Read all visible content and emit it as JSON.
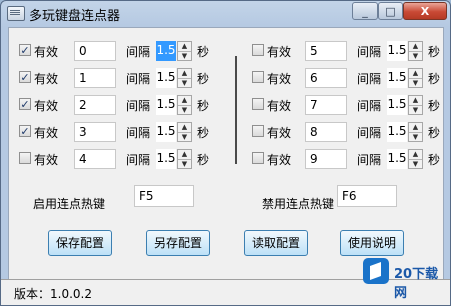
{
  "window": {
    "title": "多玩键盘连点器",
    "close_glyph": "X",
    "min_glyph": "_",
    "max_glyph": "□"
  },
  "labels": {
    "effective": "有效",
    "interval": "间隔",
    "seconds": "秒"
  },
  "left_rows": [
    {
      "checked": true,
      "key": "0",
      "interval": "1.5"
    },
    {
      "checked": true,
      "key": "1",
      "interval": "1.5"
    },
    {
      "checked": true,
      "key": "2",
      "interval": "1.5"
    },
    {
      "checked": true,
      "key": "3",
      "interval": "1.5"
    },
    {
      "checked": false,
      "key": "4",
      "interval": "1.5"
    }
  ],
  "right_rows": [
    {
      "checked": false,
      "key": "5",
      "interval": "1.5"
    },
    {
      "checked": false,
      "key": "6",
      "interval": "1.5"
    },
    {
      "checked": false,
      "key": "7",
      "interval": "1.5"
    },
    {
      "checked": false,
      "key": "8",
      "interval": "1.5"
    },
    {
      "checked": false,
      "key": "9",
      "interval": "1.5"
    }
  ],
  "hotkeys": {
    "enable_label": "启用连点热键",
    "enable_value": "F5",
    "disable_label": "禁用连点热键",
    "disable_value": "F6"
  },
  "buttons": {
    "save": "保存配置",
    "save_as": "另存配置",
    "load": "读取配置",
    "help": "使用说明"
  },
  "status": {
    "version": "版本：1.0.0.2"
  },
  "watermark": {
    "text": "20下载网"
  }
}
